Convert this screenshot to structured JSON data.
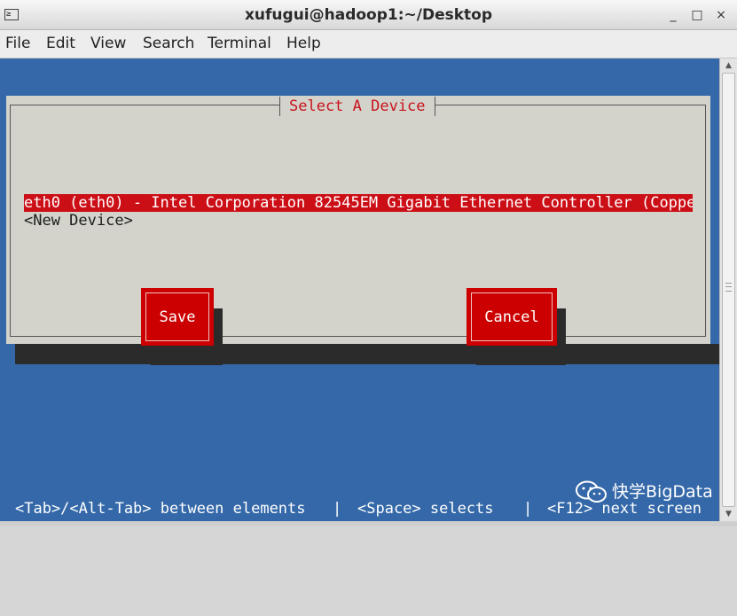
{
  "window": {
    "title": "xufugui@hadoop1:~/Desktop",
    "icons": {
      "app": "terminal-icon",
      "minimize": "minimize-icon",
      "maximize": "maximize-icon",
      "close": "close-icon"
    },
    "app_icon_text": "≥",
    "minimize_glyph": "_",
    "maximize_glyph": "□",
    "close_glyph": "×"
  },
  "menubar": {
    "items": [
      "File",
      "Edit",
      "View",
      "Search",
      "Terminal",
      "Help"
    ]
  },
  "dialog": {
    "title": "Select A Device",
    "devices": [
      {
        "label": "eth0 (eth0) - Intel Corporation 82545EM Gigabit Ethernet Controller (Coppe",
        "selected": true
      },
      {
        "label": "<New Device>",
        "selected": false
      }
    ],
    "save_label": "Save",
    "cancel_label": "Cancel"
  },
  "statusbar": {
    "tab_hint": "<Tab>/<Alt-Tab> between elements",
    "sep1": "|",
    "space_hint": "<Space> selects",
    "sep2": "|",
    "f12_hint": "<F12> next screen"
  },
  "watermark": {
    "icon": "wechat-icon",
    "text": "快学BigData"
  },
  "colors": {
    "terminal_bg": "#3468a8",
    "dialog_bg": "#d3d3cc",
    "accent_red": "#cc0f17",
    "dialog_title": "#c8141c"
  }
}
